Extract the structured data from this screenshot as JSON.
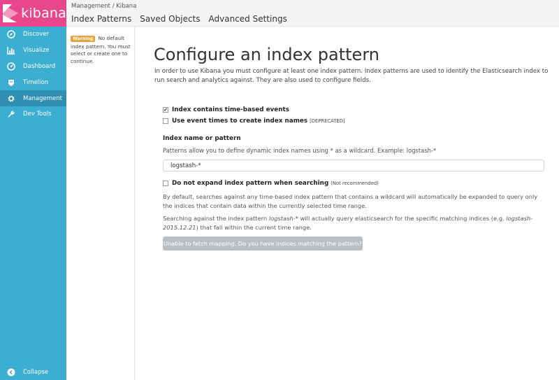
{
  "brand": {
    "name": "kibana"
  },
  "sidebar": {
    "items": [
      {
        "label": "Discover",
        "icon": "compass-icon",
        "active": false
      },
      {
        "label": "Visualize",
        "icon": "bar-chart-icon",
        "active": false
      },
      {
        "label": "Dashboard",
        "icon": "dashboard-icon",
        "active": false
      },
      {
        "label": "Timelion",
        "icon": "shield-icon",
        "active": false
      },
      {
        "label": "Management",
        "icon": "gear-icon",
        "active": true
      },
      {
        "label": "Dev Tools",
        "icon": "wrench-icon",
        "active": false
      }
    ],
    "collapse_label": "Collapse"
  },
  "header": {
    "breadcrumb": "Management / Kibana",
    "tabs": [
      "Index Patterns",
      "Saved Objects",
      "Advanced Settings"
    ]
  },
  "warning": {
    "badge": "Warning",
    "text": "No default index pattern. You must select or create one to continue."
  },
  "main": {
    "title": "Configure an index pattern",
    "intro": "In order to use Kibana you must configure at least one index pattern. Index patterns are used to identify the Elasticsearch index to run search and analytics against. They are also used to configure fields.",
    "time_based": {
      "label": "Index contains time-based events",
      "checked": true
    },
    "event_times": {
      "label": "Use event times to create index names",
      "note": "[DEPRECATED]",
      "checked": false
    },
    "index_label": "Index name or pattern",
    "index_help": "Patterns allow you to define dynamic index names using * as a wildcard. Example: logstash-*",
    "index_value": "logstash-*",
    "no_expand": {
      "label": "Do not expand index pattern when searching",
      "note": "(Not recommended)",
      "checked": false
    },
    "para1": "By default, searches against any time-based index pattern that contains a wildcard will automatically be expanded to query only the indices that contain data within the currently selected time range.",
    "para2_prefix": "Searching against the index pattern ",
    "para2_pattern": "logstash-*",
    "para2_middle": " will actually query elasticsearch for the specific matching indices (e.g. ",
    "para2_example": "logstash-2015.12.21",
    "para2_suffix": ") that fall within the current time range.",
    "button_label": "Unable to fetch mapping. Do you have indices matching the pattern?"
  },
  "colors": {
    "sidebar": "#3caed2",
    "sidebar_active": "#2e8fb2",
    "logo_bg": "#e8488b",
    "warning": "#e8a23c",
    "button_disabled": "#b8c0c4"
  }
}
